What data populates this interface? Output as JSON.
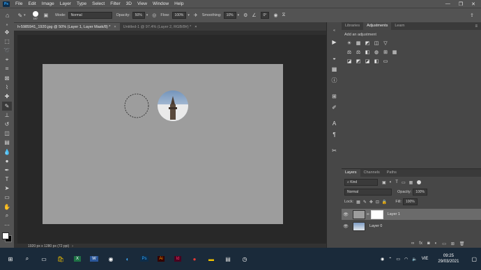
{
  "menubar": {
    "app_logo": "Ps",
    "items": [
      "File",
      "Edit",
      "Image",
      "Layer",
      "Type",
      "Select",
      "Filter",
      "3D",
      "View",
      "Window",
      "Help"
    ],
    "window_controls": [
      "—",
      "❐",
      "✕"
    ]
  },
  "options": {
    "brush_size": "187",
    "mode_label": "Mode:",
    "mode_value": "Normal",
    "opacity_label": "Opacity:",
    "opacity_value": "50%",
    "flow_label": "Flow:",
    "flow_value": "100%",
    "smoothing_label": "Smoothing:",
    "smoothing_value": "10%",
    "angle_value": "0°"
  },
  "tabs": [
    {
      "label": "h-5985941_1920.jpg @ 50% (Layer 1, Layer Mask/8) *",
      "active": true
    },
    {
      "label": "Untitled-1 @ 97.4% (Layer 2, RGB/8#) *",
      "active": false
    }
  ],
  "status_text": "1920 px x 1280 px (72 ppi)",
  "panels": {
    "top_tabs": [
      "Libraries",
      "Adjustments",
      "Learn"
    ],
    "add_adjustment_label": "Add an adjustment",
    "adj_icons_row1": [
      "☀",
      "▦",
      "◩",
      "◫",
      "▽"
    ],
    "adj_icons_row2": [
      "⚖",
      "⚖",
      "◧",
      "◍",
      "⊞",
      "▦"
    ],
    "adj_icons_row3": [
      "◪",
      "◩",
      "◪",
      "◧",
      "▭"
    ],
    "layer_tabs": [
      "Layers",
      "Channels",
      "Paths"
    ],
    "kind_label": "Kind",
    "blend_mode": "Normal",
    "opacity_label": "Opacity:",
    "opacity_value": "100%",
    "lock_label": "Lock:",
    "fill_label": "Fill:",
    "fill_value": "100%",
    "layers": [
      {
        "name": "Layer 1",
        "selected": true
      },
      {
        "name": "Layer 0",
        "selected": false
      }
    ]
  },
  "taskbar": {
    "lang": "VIE",
    "time": "09:25",
    "date": "29/03/2021"
  },
  "colors": {
    "accent_blue": "#31a8ff",
    "canvas_gray": "#9d9d9d",
    "panel_bg": "#474747"
  }
}
